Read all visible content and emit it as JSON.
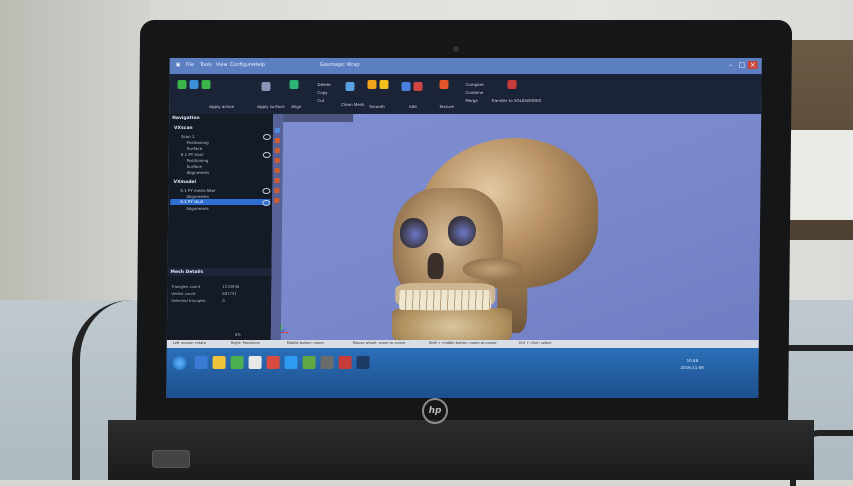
{
  "window": {
    "title": "Geomagic Wrap",
    "min": "–",
    "max": "□",
    "close": "×"
  },
  "menu": [
    "File",
    "Tools",
    "View",
    "Configure",
    "Help"
  ],
  "ribbon": {
    "groups": [
      {
        "label": "Apply active"
      },
      {
        "label": "Apply surface"
      },
      {
        "label": "Align"
      },
      {
        "label": "Delete"
      },
      {
        "label": "Copy"
      },
      {
        "label": "Cut"
      },
      {
        "label": "Clean Mesh"
      },
      {
        "label": "Smooth"
      },
      {
        "label": "Edit"
      },
      {
        "label": "Texture"
      },
      {
        "label": "Compare"
      },
      {
        "label": "Combine"
      },
      {
        "label": "Merge"
      },
      {
        "label": "Transfer to SOLIDWORKS"
      }
    ]
  },
  "nav": {
    "title": "Navigation",
    "sections": [
      {
        "name": "VXscan",
        "items": [
          "Scan 1",
          "Positioning",
          "Surface",
          "6.1 PY skull",
          "Positioning",
          "Surface",
          "Alignments"
        ]
      },
      {
        "name": "VXmodel",
        "items": [
          "6.1 PY mesh-filter",
          "Alignments",
          "6.1 PY skull",
          "Alignments"
        ]
      }
    ],
    "selected": "6.1 PY skull"
  },
  "details": {
    "title": "Mesh Details",
    "rows": [
      {
        "label": "Triangles count",
        "value": "1233936"
      },
      {
        "label": "Vertex count",
        "value": "607751"
      },
      {
        "label": "Selected triangles",
        "value": "0"
      }
    ],
    "footer": "0%"
  },
  "status": {
    "items": [
      "Left mouse: rotate",
      "Right: Pan/zoom",
      "Middle button: zoom",
      "Mouse wheel: zoom to cursor",
      "Shift + middle button: zoom at cursor",
      "Ctrl + click: select"
    ]
  },
  "taskbar": {
    "tray_time": "10:48",
    "tray_date": "2016-11-08"
  },
  "device": {
    "brand": "hp"
  },
  "colors": {
    "viewport_bg": "#7e8cd0",
    "selection": "#2f6fd1",
    "taskbar": "#2b6fb8"
  }
}
